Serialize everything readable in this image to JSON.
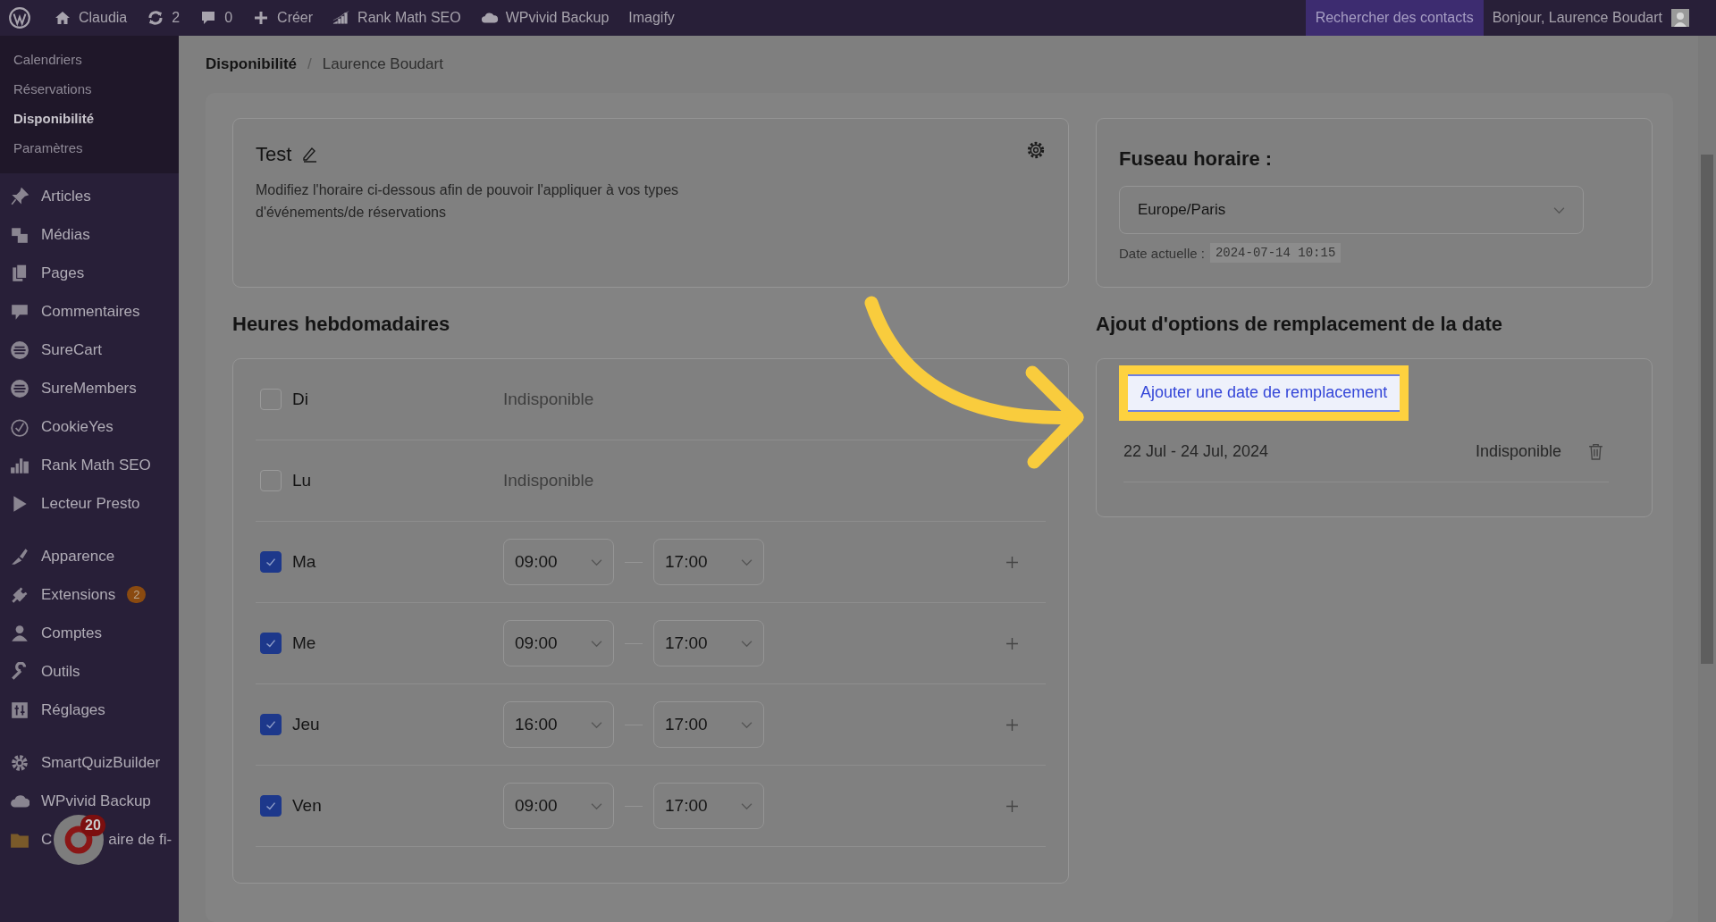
{
  "admin_bar": {
    "items": [
      {
        "kind": "wordpress"
      },
      {
        "kind": "home",
        "label": "Claudia"
      },
      {
        "kind": "refresh",
        "label": "2"
      },
      {
        "kind": "comment",
        "label": "0"
      },
      {
        "kind": "plus",
        "label": "Créer"
      },
      {
        "kind": "chart",
        "label": "Rank Math SEO"
      },
      {
        "kind": "cloud",
        "label": "WPvivid Backup"
      },
      {
        "kind": "text",
        "label": "Imagify"
      }
    ],
    "search_button": "Rechercher des contacts",
    "greeting": "Bonjour, Laurence Boudart"
  },
  "sidebar": {
    "submenu": [
      {
        "label": "Calendriers",
        "selected": false
      },
      {
        "label": "Réservations",
        "selected": false
      },
      {
        "label": "Disponibilité",
        "selected": true
      },
      {
        "label": "Paramètres",
        "selected": false
      }
    ],
    "groups": [
      [
        {
          "label": "Articles",
          "kind": "pin"
        },
        {
          "label": "Médias",
          "kind": "media"
        },
        {
          "label": "Pages",
          "kind": "pages"
        },
        {
          "label": "Commentaires",
          "kind": "comment"
        },
        {
          "label": "SureCart",
          "kind": "stripes"
        },
        {
          "label": "SureMembers",
          "kind": "stripes"
        },
        {
          "label": "CookieYes",
          "kind": "cookie"
        },
        {
          "label": "Rank Math SEO",
          "kind": "chart"
        },
        {
          "label": "Lecteur Presto",
          "kind": "play"
        }
      ],
      [
        {
          "label": "Apparence",
          "kind": "brush"
        },
        {
          "label": "Extensions",
          "kind": "plug",
          "badge": "2"
        },
        {
          "label": "Comptes",
          "kind": "user"
        },
        {
          "label": "Outils",
          "kind": "wrench"
        },
        {
          "label": "Réglages",
          "kind": "sliders"
        }
      ],
      [
        {
          "label": "SmartQuizBuilder",
          "kind": "gear"
        },
        {
          "label": "WPvivid Backup",
          "kind": "cloud"
        },
        {
          "label": "C",
          "label_after": "aire de fi-",
          "kind": "folder"
        }
      ]
    ]
  },
  "chat_widget": {
    "badge": "20"
  },
  "breadcrumb": {
    "current": "Disponibilité",
    "separator": "/",
    "name": "Laurence Boudart"
  },
  "schedule": {
    "title": "Test",
    "description": "Modifiez l'horaire ci-dessous afin de pouvoir l'appliquer à vos types d'événements/de réservations"
  },
  "timezone": {
    "title": "Fuseau horaire :",
    "value": "Europe/Paris",
    "date_label": "Date actuelle :",
    "date": "2024-07-14 10:15"
  },
  "weekly_hours": {
    "title": "Heures hebdomadaires",
    "days": [
      {
        "label": "Di",
        "checked": false,
        "status": "Indisponible"
      },
      {
        "label": "Lu",
        "checked": false,
        "status": "Indisponible"
      },
      {
        "label": "Ma",
        "checked": true,
        "start": "09:00",
        "end": "17:00"
      },
      {
        "label": "Me",
        "checked": true,
        "start": "09:00",
        "end": "17:00"
      },
      {
        "label": "Jeu",
        "checked": true,
        "start": "16:00",
        "end": "17:00"
      },
      {
        "label": "Ven",
        "checked": true,
        "start": "09:00",
        "end": "17:00"
      }
    ]
  },
  "date_overrides": {
    "title": "Ajout d'options de remplacement de la date",
    "add_button": "Ajouter une date de remplacement",
    "highlighted": true,
    "entries": [
      {
        "range": "22 Jul - 24 Jul, 2024",
        "status": "Indisponible"
      }
    ]
  }
}
